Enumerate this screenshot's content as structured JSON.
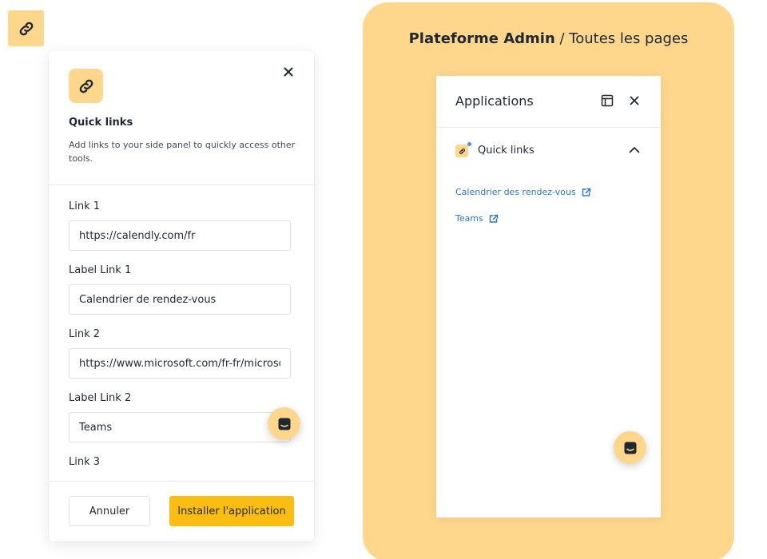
{
  "corner_icon": "link-icon",
  "config_panel": {
    "title": "Quick links",
    "description": "Add links to your side panel to quickly access other tools.",
    "fields": [
      {
        "label": "Link 1",
        "value": "https://calendly.com/fr"
      },
      {
        "label": "Label Link 1",
        "value": "Calendrier de rendez-vous"
      },
      {
        "label": "Link 2",
        "value": "https://www.microsoft.com/fr-fr/microsoft-teams"
      },
      {
        "label": "Label Link 2",
        "value": "Teams"
      },
      {
        "label": "Link 3",
        "value": ""
      }
    ],
    "cancel_label": "Annuler",
    "install_label": "Installer l'application"
  },
  "preview": {
    "heading_bold": "Plateforme Admin",
    "heading_rest": " / Toutes les pages",
    "panel_title": "Applications",
    "section_label": "Quick links",
    "links": [
      {
        "label": "Calendrier des rendez-vous"
      },
      {
        "label": "Teams"
      }
    ]
  },
  "colors": {
    "accent": "#fbbd12",
    "badge": "#fed78c",
    "link": "#2f78c4"
  }
}
